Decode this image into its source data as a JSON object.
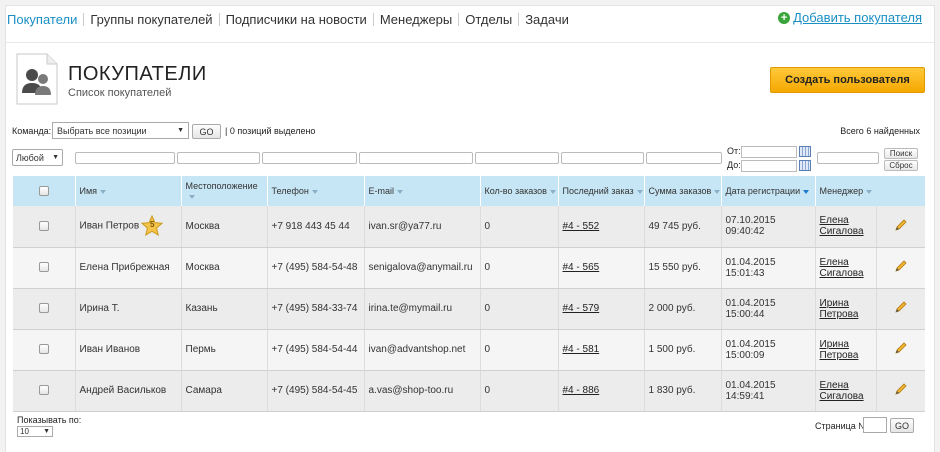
{
  "nav": {
    "items": [
      "Покупатели",
      "Группы покупателей",
      "Подписчики на новости",
      "Менеджеры",
      "Отделы",
      "Задачи"
    ],
    "add_link": "Добавить покупателя"
  },
  "header": {
    "title": "ПОКУПАТЕЛИ",
    "subtitle": "Список покупателей",
    "create_button": "Создать пользователя"
  },
  "command": {
    "label": "Команда:",
    "selected": "Выбрать все позиции",
    "go": "GO",
    "selection_info": "| 0 позиций выделено",
    "found": "Всего 6 найденных"
  },
  "filters": {
    "select_value": "Любой",
    "from_label": "От:",
    "to_label": "До:",
    "search_button": "Поиск",
    "reset_button": "Сброс"
  },
  "table": {
    "columns": [
      "Имя",
      "Местоположение",
      "Телефон",
      "E-mail",
      "Кол-во заказов",
      "Последний заказ",
      "Сумма заказов",
      "Дата регистрации",
      "Менеджер"
    ],
    "rows": [
      {
        "name": "Иван Петров",
        "badge": "5",
        "location": "Москва",
        "phone": "+7 918 443 45 44",
        "email": "ivan.sr@ya77.ru",
        "orders": "0",
        "last_order": "#4 - 552",
        "sum": "49 745 руб.",
        "reg_date": "07.10.2015",
        "reg_time": "09:40:42",
        "manager_first": "Елена",
        "manager_last": "Сигалова"
      },
      {
        "name": "Елена Прибрежная",
        "badge": "",
        "location": "Москва",
        "phone": "+7 (495) 584-54-48",
        "email": "senigalova@anymail.ru",
        "orders": "0",
        "last_order": "#4 - 565",
        "sum": "15 550 руб.",
        "reg_date": "01.04.2015",
        "reg_time": "15:01:43",
        "manager_first": "Елена",
        "manager_last": "Сигалова"
      },
      {
        "name": "Ирина Т.",
        "badge": "",
        "location": "Казань",
        "phone": "+7 (495) 584-33-74",
        "email": "irina.te@mymail.ru",
        "orders": "0",
        "last_order": "#4 - 579",
        "sum": "2 000 руб.",
        "reg_date": "01.04.2015",
        "reg_time": "15:00:44",
        "manager_first": "Ирина",
        "manager_last": "Петрова"
      },
      {
        "name": "Иван Иванов",
        "badge": "",
        "location": "Пермь",
        "phone": "+7 (495) 584-54-44",
        "email": "ivan@advantshop.net",
        "orders": "0",
        "last_order": "#4 - 581",
        "sum": "1 500 руб.",
        "reg_date": "01.04.2015",
        "reg_time": "15:00:09",
        "manager_first": "Ирина",
        "manager_last": "Петрова"
      },
      {
        "name": "Андрей Васильков",
        "badge": "",
        "location": "Самара",
        "phone": "+7 (495) 584-54-45",
        "email": "a.vas@shop-too.ru",
        "orders": "0",
        "last_order": "#4 - 886",
        "sum": "1 830 руб.",
        "reg_date": "01.04.2015",
        "reg_time": "14:59:41",
        "manager_first": "Елена",
        "manager_last": "Сигалова"
      }
    ]
  },
  "footer": {
    "show_label": "Показывать по:",
    "show_value": "10",
    "page_label": "Страница №",
    "go": "GO"
  }
}
